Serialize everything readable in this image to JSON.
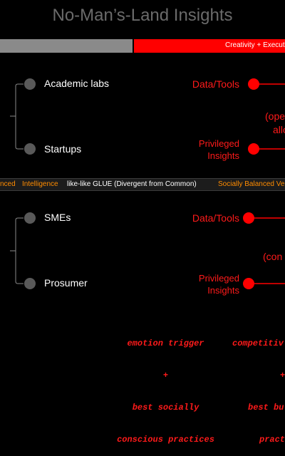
{
  "title": "No-Man’s-Land Insights",
  "top_bar": {
    "right_label": "Creativity + Execut"
  },
  "section1": {
    "nodes": [
      "Academic labs",
      "Startups"
    ],
    "data_tools": "Data/Tools",
    "privileged": [
      "Privileged",
      "Insights"
    ],
    "paren_lines": [
      "(ope",
      "allo"
    ]
  },
  "glue_bar": {
    "left": "nced",
    "intelligence": "Intelligence",
    "middle": "like-like GLUE (Divergent from Common)",
    "right": "Socially Balanced Ve"
  },
  "section2": {
    "nodes": [
      "SMEs",
      "Prosumer"
    ],
    "data_tools": "Data/Tools",
    "privileged": [
      "Privileged",
      "Insights"
    ],
    "paren_line": "(con"
  },
  "bottom": {
    "left_lines": [
      "emotion trigger",
      "+",
      "best socially",
      "conscious practices"
    ],
    "right_lines": [
      "competitiv",
      "+",
      "best bu",
      "pract"
    ]
  },
  "colors": {
    "red": "#ff0000",
    "grey_bar": "#8a8a8a",
    "node_grey": "#595959",
    "title": "#6a6a6a",
    "glue_orange": "#ff8c00"
  }
}
